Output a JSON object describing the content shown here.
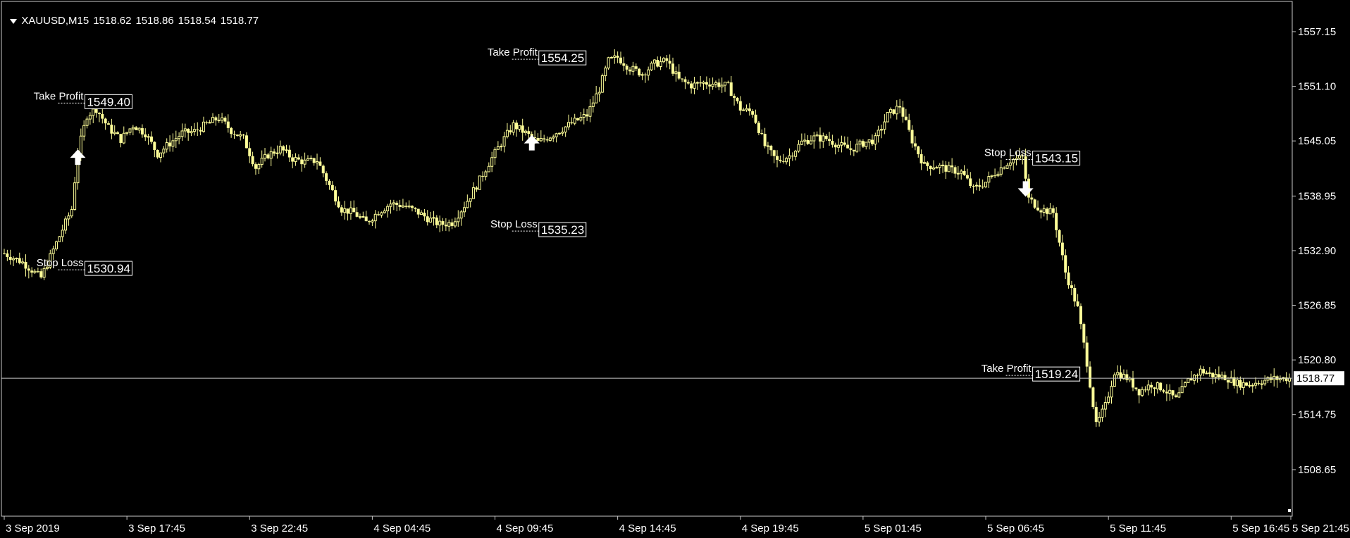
{
  "header": {
    "symbol": "XAUUSD,M15",
    "open": "1518.62",
    "high": "1518.86",
    "low": "1518.54",
    "close": "1518.77"
  },
  "chart_data": {
    "type": "candlestick",
    "symbol": "XAUUSD",
    "timeframe": "M15",
    "ylim": [
      1503.5,
      1560.5
    ],
    "y_ticks": [
      "1557.15",
      "1551.10",
      "1545.05",
      "1538.95",
      "1532.90",
      "1526.85",
      "1520.80",
      "1514.75",
      "1508.65"
    ],
    "x_ticks": [
      "3 Sep 2019",
      "3 Sep 17:45",
      "3 Sep 22:45",
      "4 Sep 04:45",
      "4 Sep 09:45",
      "4 Sep 14:45",
      "4 Sep 19:45",
      "5 Sep 01:45",
      "5 Sep 06:45",
      "5 Sep 11:45",
      "5 Sep 16:45",
      "5 Sep 21:45"
    ],
    "current_price": "1518.77",
    "price_path": [
      [
        0,
        1532.6
      ],
      [
        6,
        1531.6
      ],
      [
        12,
        1529.9
      ],
      [
        16,
        1533.0
      ],
      [
        20,
        1536.0
      ],
      [
        22,
        1537.5
      ],
      [
        24,
        1543.8
      ],
      [
        27,
        1547.9
      ],
      [
        30,
        1548.6
      ],
      [
        34,
        1546.5
      ],
      [
        38,
        1545.2
      ],
      [
        42,
        1546.8
      ],
      [
        46,
        1545.9
      ],
      [
        50,
        1543.6
      ],
      [
        54,
        1544.8
      ],
      [
        58,
        1545.9
      ],
      [
        62,
        1546.1
      ],
      [
        66,
        1546.9
      ],
      [
        70,
        1547.6
      ],
      [
        74,
        1546.2
      ],
      [
        78,
        1545.3
      ],
      [
        82,
        1542.1
      ],
      [
        86,
        1543.5
      ],
      [
        90,
        1544.2
      ],
      [
        94,
        1543.1
      ],
      [
        98,
        1542.7
      ],
      [
        102,
        1542.9
      ],
      [
        106,
        1540.1
      ],
      [
        110,
        1537.5
      ],
      [
        114,
        1537.1
      ],
      [
        118,
        1536.0
      ],
      [
        122,
        1537.2
      ],
      [
        126,
        1538.1
      ],
      [
        130,
        1537.9
      ],
      [
        134,
        1537.3
      ],
      [
        138,
        1536.5
      ],
      [
        142,
        1535.8
      ],
      [
        146,
        1536.0
      ],
      [
        150,
        1537.9
      ],
      [
        154,
        1540.1
      ],
      [
        158,
        1542.6
      ],
      [
        162,
        1544.8
      ],
      [
        166,
        1546.8
      ],
      [
        170,
        1545.9
      ],
      [
        174,
        1544.9
      ],
      [
        178,
        1545.6
      ],
      [
        182,
        1546.4
      ],
      [
        186,
        1547.2
      ],
      [
        190,
        1547.9
      ],
      [
        194,
        1550.8
      ],
      [
        197,
        1553.9
      ],
      [
        200,
        1554.3
      ],
      [
        204,
        1553.1
      ],
      [
        208,
        1552.5
      ],
      [
        212,
        1553.6
      ],
      [
        216,
        1553.9
      ],
      [
        220,
        1551.8
      ],
      [
        224,
        1551.2
      ],
      [
        228,
        1551.5
      ],
      [
        232,
        1551.4
      ],
      [
        236,
        1551.1
      ],
      [
        240,
        1548.6
      ],
      [
        244,
        1548.2
      ],
      [
        248,
        1544.5
      ],
      [
        252,
        1542.8
      ],
      [
        256,
        1543.4
      ],
      [
        260,
        1544.9
      ],
      [
        264,
        1545.4
      ],
      [
        268,
        1545.3
      ],
      [
        272,
        1544.6
      ],
      [
        276,
        1544.1
      ],
      [
        280,
        1544.8
      ],
      [
        284,
        1545.2
      ],
      [
        288,
        1547.9
      ],
      [
        292,
        1548.9
      ],
      [
        296,
        1545.1
      ],
      [
        300,
        1542.3
      ],
      [
        304,
        1542.3
      ],
      [
        308,
        1541.9
      ],
      [
        312,
        1541.6
      ],
      [
        316,
        1539.7
      ],
      [
        320,
        1540.5
      ],
      [
        324,
        1541.8
      ],
      [
        328,
        1542.9
      ],
      [
        332,
        1543.2
      ],
      [
        334,
        1538.6
      ],
      [
        338,
        1537.5
      ],
      [
        342,
        1537.1
      ],
      [
        346,
        1530.5
      ],
      [
        350,
        1526.5
      ],
      [
        353,
        1520.5
      ],
      [
        356,
        1513.5
      ],
      [
        359,
        1515.7
      ],
      [
        362,
        1519.5
      ],
      [
        366,
        1518.8
      ],
      [
        370,
        1517.3
      ],
      [
        374,
        1518.1
      ],
      [
        378,
        1517.6
      ],
      [
        382,
        1516.4
      ],
      [
        386,
        1518.5
      ],
      [
        390,
        1519.6
      ],
      [
        394,
        1519.1
      ],
      [
        398,
        1518.9
      ],
      [
        402,
        1518.2
      ],
      [
        406,
        1518.1
      ],
      [
        410,
        1518.5
      ],
      [
        414,
        1518.7
      ],
      [
        418,
        1518.77
      ]
    ],
    "orders": [
      {
        "dir": "up",
        "at": 24
      },
      {
        "dir": "up",
        "at": 172
      },
      {
        "dir": "down",
        "at": 333
      }
    ],
    "levels": [
      {
        "kind": "Take Profit",
        "price": "1549.40",
        "at": 24
      },
      {
        "kind": "Stop Loss",
        "price": "1530.94",
        "at": 24
      },
      {
        "kind": "Take Profit",
        "price": "1554.25",
        "at": 172
      },
      {
        "kind": "Stop Loss",
        "price": "1535.23",
        "at": 172
      },
      {
        "kind": "Stop Loss",
        "price": "1543.15",
        "at": 333
      },
      {
        "kind": "Take Profit",
        "price": "1519.24",
        "at": 333
      }
    ],
    "colors": {
      "background": "#000000",
      "candle": "#ffff99",
      "axis": "#c8c8c8",
      "text": "#ffffff"
    }
  }
}
